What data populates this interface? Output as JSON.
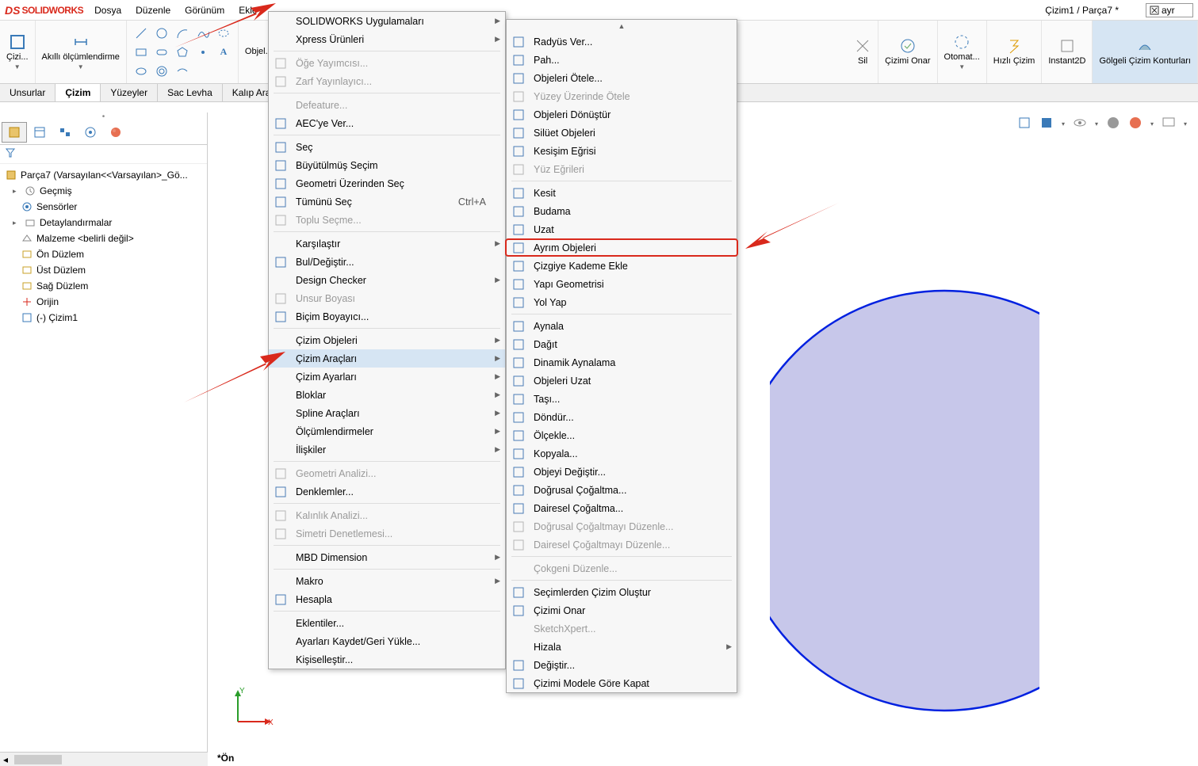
{
  "title_bar": {
    "logo_ds": "DS",
    "logo_sw": "SOLIDWORKS",
    "menu": [
      "Dosya",
      "Düzenle",
      "Görünüm",
      "Ekle"
    ],
    "doc": "Çizim1 / Parça7 *",
    "search_text": "ayr"
  },
  "toolbar": {
    "sketch": "Çizi...",
    "smart_dim": "Akıllı ölçümlendirme",
    "objects": "Objel...",
    "delete": "Sil",
    "repair": "Çizimi Onar",
    "auto": "Otomat...",
    "quick": "Hızlı Çizim",
    "instant": "Instant2D",
    "shaded": "Gölgeli Çizim Konturları"
  },
  "tabs": [
    "Unsurlar",
    "Çizim",
    "Yüzeyler",
    "Sac Levha",
    "Kalıp Araç..."
  ],
  "tree": {
    "root": "Parça7 (Varsayılan<<Varsayılan>_Gö...",
    "items": [
      "Geçmiş",
      "Sensörler",
      "Detaylandırmalar",
      "Malzeme <belirli değil>",
      "Ön Düzlem",
      "Üst Düzlem",
      "Sağ Düzlem",
      "Orijin",
      "(-) Çizim1"
    ]
  },
  "view_label": "*Ön",
  "menu1": {
    "items": [
      {
        "t": "SOLIDWORKS Uygulamaları",
        "sub": true
      },
      {
        "t": "Xpress Ürünleri",
        "sub": true
      },
      {
        "sep": true
      },
      {
        "t": "Öğe Yayımcısı...",
        "dis": true,
        "i": "doc"
      },
      {
        "t": "Zarf Yayınlayıcı...",
        "dis": true,
        "i": "env"
      },
      {
        "sep": true
      },
      {
        "t": "Defeature...",
        "dis": true
      },
      {
        "t": "AEC'ye Ver...",
        "i": "aec"
      },
      {
        "sep": true
      },
      {
        "t": "Seç",
        "i": "cursor"
      },
      {
        "t": "Büyütülmüş Seçim",
        "i": "mag"
      },
      {
        "t": "Geometri Üzerinden Seç",
        "i": "geo"
      },
      {
        "t": "Tümünü Seç",
        "sc": "Ctrl+A",
        "i": "all"
      },
      {
        "t": "Toplu Seçme...",
        "dis": true,
        "i": "multi"
      },
      {
        "sep": true
      },
      {
        "t": "Karşılaştır",
        "sub": true
      },
      {
        "t": "Bul/Değiştir...",
        "i": "find"
      },
      {
        "t": "Design Checker",
        "sub": true
      },
      {
        "t": "Unsur Boyası",
        "dis": true,
        "i": "brush"
      },
      {
        "t": "Biçim Boyayıcı...",
        "i": "fmt"
      },
      {
        "sep": true
      },
      {
        "t": "Çizim Objeleri",
        "sub": true
      },
      {
        "t": "Çizim Araçları",
        "sub": true,
        "hover": true
      },
      {
        "t": "Çizim Ayarları",
        "sub": true
      },
      {
        "t": "Bloklar",
        "sub": true
      },
      {
        "t": "Spline Araçları",
        "sub": true
      },
      {
        "t": "Ölçümlendirmeler",
        "sub": true
      },
      {
        "t": "İlişkiler",
        "sub": true
      },
      {
        "sep": true
      },
      {
        "t": "Geometri Analizi...",
        "dis": true,
        "i": "ga"
      },
      {
        "t": "Denklemler...",
        "i": "eq"
      },
      {
        "sep": true
      },
      {
        "t": "Kalınlık Analizi...",
        "dis": true,
        "i": "th"
      },
      {
        "t": "Simetri Denetlemesi...",
        "dis": true,
        "i": "sym"
      },
      {
        "sep": true
      },
      {
        "t": "MBD Dimension",
        "sub": true
      },
      {
        "sep": true
      },
      {
        "t": "Makro",
        "sub": true
      },
      {
        "t": "Hesapla",
        "i": "calc"
      },
      {
        "sep": true
      },
      {
        "t": "Eklentiler..."
      },
      {
        "t": "Ayarları Kaydet/Geri Yükle..."
      },
      {
        "t": "Kişiselleştir..."
      }
    ]
  },
  "menu2": {
    "items": [
      {
        "t": "Radyüs Ver...",
        "i": "rad"
      },
      {
        "t": "Pah...",
        "i": "pah"
      },
      {
        "t": "Objeleri Ötele...",
        "i": "off"
      },
      {
        "t": "Yüzey Üzerinde Ötele",
        "dis": true,
        "i": "offs"
      },
      {
        "t": "Objeleri Dönüştür",
        "i": "conv"
      },
      {
        "t": "Silüet Objeleri",
        "i": "sil"
      },
      {
        "t": "Kesişim Eğrisi",
        "i": "int"
      },
      {
        "t": "Yüz Eğrileri",
        "dis": true,
        "i": "fc"
      },
      {
        "sep": true
      },
      {
        "t": "Kesit",
        "i": "sec"
      },
      {
        "t": "Budama",
        "i": "trim"
      },
      {
        "t": "Uzat",
        "i": "ext"
      },
      {
        "t": "Ayrım Objeleri",
        "i": "split",
        "hl": true
      },
      {
        "t": "Çizgiye Kademe Ekle",
        "i": "jog"
      },
      {
        "t": "Yapı Geometrisi",
        "i": "con"
      },
      {
        "t": "Yol Yap",
        "i": "path"
      },
      {
        "sep": true
      },
      {
        "t": "Aynala",
        "i": "mir"
      },
      {
        "t": "Dağıt",
        "i": "dis2"
      },
      {
        "t": "Dinamik Aynalama",
        "i": "dmir"
      },
      {
        "t": "Objeleri Uzat",
        "i": "str"
      },
      {
        "t": "Taşı...",
        "i": "mv"
      },
      {
        "t": "Döndür...",
        "i": "rot"
      },
      {
        "t": "Ölçekle...",
        "i": "scl"
      },
      {
        "t": "Kopyala...",
        "i": "cpy"
      },
      {
        "t": "Objeyi Değiştir...",
        "i": "rep"
      },
      {
        "t": "Doğrusal Çoğaltma...",
        "i": "lp"
      },
      {
        "t": "Dairesel Çoğaltma...",
        "i": "cp"
      },
      {
        "t": "Doğrusal Çoğaltmayı Düzenle...",
        "dis": true,
        "i": "lpe"
      },
      {
        "t": "Dairesel Çoğaltmayı Düzenle...",
        "dis": true,
        "i": "cpe"
      },
      {
        "sep": true
      },
      {
        "t": "Çokgeni Düzenle...",
        "dis": true
      },
      {
        "sep": true
      },
      {
        "t": "Seçimlerden Çizim Oluştur",
        "i": "mk"
      },
      {
        "t": "Çizimi Onar",
        "i": "rp"
      },
      {
        "t": "SketchXpert...",
        "dis": true
      },
      {
        "t": "Hizala",
        "sub": true
      },
      {
        "t": "Değiştir...",
        "i": "mod"
      },
      {
        "t": "Çizimi Modele Göre Kapat",
        "i": "cl"
      }
    ]
  }
}
